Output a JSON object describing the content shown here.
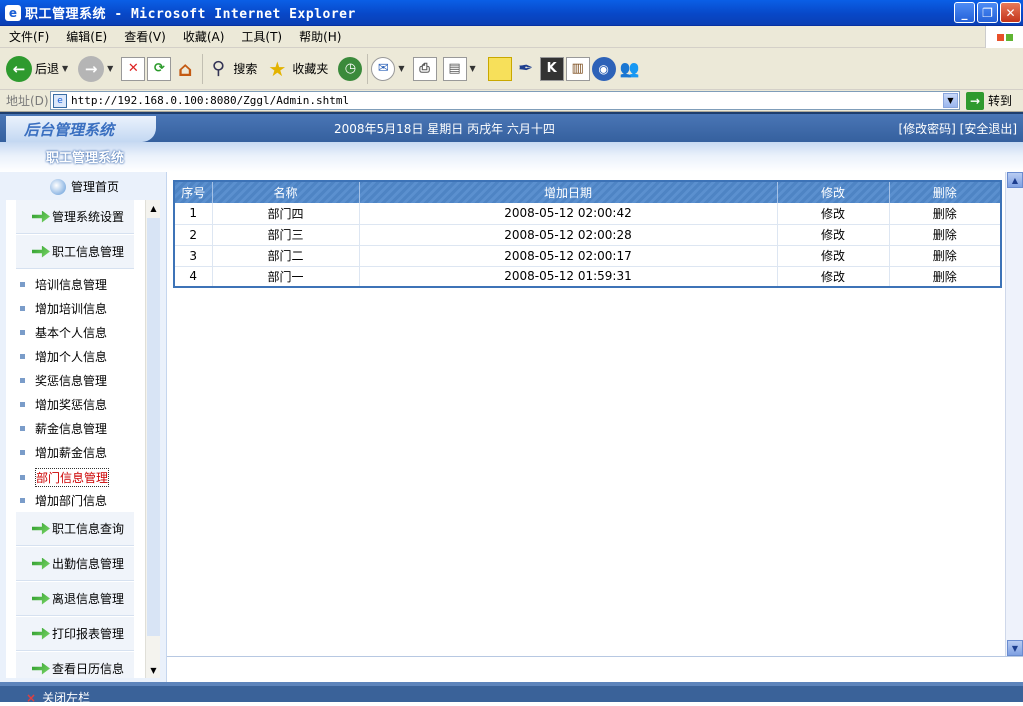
{
  "window": {
    "title": "职工管理系统 - Microsoft Internet Explorer"
  },
  "menu": [
    "文件(F)",
    "编辑(E)",
    "查看(V)",
    "收藏(A)",
    "工具(T)",
    "帮助(H)"
  ],
  "toolbar": {
    "back": "后退",
    "search": "搜索",
    "favorites": "收藏夹"
  },
  "address": {
    "label": "地址(D)",
    "url": "http://192.168.0.100:8080/Zggl/Admin.shtml",
    "go": "转到"
  },
  "header": {
    "logo": "后台管理系统",
    "date": "2008年5月18日 星期日 丙戌年 六月十四",
    "links": "[修改密码] [安全退出]",
    "system": "职工管理系统"
  },
  "sidebar": {
    "home": "管理首页",
    "groups_top": [
      "管理系统设置",
      "职工信息管理"
    ],
    "items": [
      "培训信息管理",
      "增加培训信息",
      "基本个人信息",
      "增加个人信息",
      "奖惩信息管理",
      "增加奖惩信息",
      "薪金信息管理",
      "增加薪金信息",
      "部门信息管理",
      "增加部门信息"
    ],
    "active_item": "部门信息管理",
    "groups_bottom": [
      "职工信息查询",
      "出勤信息管理",
      "离退信息管理",
      "打印报表管理",
      "查看日历信息"
    ]
  },
  "table": {
    "headers": [
      "序号",
      "名称",
      "增加日期",
      "修改",
      "删除"
    ],
    "rows": [
      [
        "1",
        "部门四",
        "2008-05-12 02:00:42",
        "修改",
        "删除"
      ],
      [
        "2",
        "部门三",
        "2008-05-12 02:00:28",
        "修改",
        "删除"
      ],
      [
        "3",
        "部门二",
        "2008-05-12 02:00:17",
        "修改",
        "删除"
      ],
      [
        "4",
        "部门一",
        "2008-05-12 01:59:31",
        "修改",
        "删除"
      ]
    ]
  },
  "footer": {
    "close": "关闭左栏"
  }
}
